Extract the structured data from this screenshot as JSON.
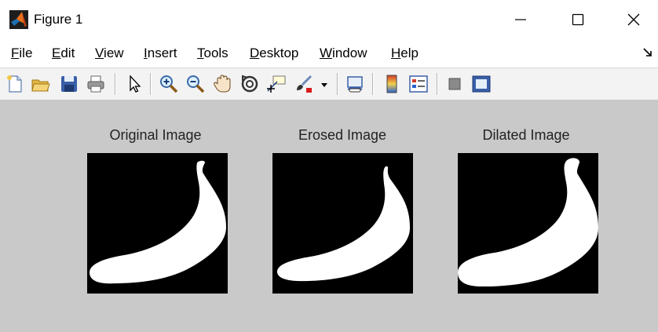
{
  "window": {
    "title": "Figure 1",
    "icon": "matlab-logo-icon",
    "controls": [
      "minimize-icon",
      "maximize-icon",
      "close-icon"
    ]
  },
  "menubar": {
    "items": [
      {
        "label": "File",
        "mnemonic": "F"
      },
      {
        "label": "Edit",
        "mnemonic": "E"
      },
      {
        "label": "View",
        "mnemonic": "V"
      },
      {
        "label": "Insert",
        "mnemonic": "I"
      },
      {
        "label": "Tools",
        "mnemonic": "T"
      },
      {
        "label": "Desktop",
        "mnemonic": "D"
      },
      {
        "label": "Window",
        "mnemonic": "W"
      },
      {
        "label": "Help",
        "mnemonic": "H"
      }
    ]
  },
  "toolbar": {
    "buttons": [
      "new-figure-icon",
      "open-icon",
      "save-icon",
      "print-icon",
      "pointer-icon",
      "zoom-in-icon",
      "zoom-out-icon",
      "pan-icon",
      "rotate-3d-icon",
      "data-cursor-icon",
      "brush-icon",
      "link-plot-icon",
      "colorbar-icon",
      "legend-icon",
      "hide-plot-tools-icon",
      "show-plot-tools-icon"
    ]
  },
  "figure": {
    "axes": [
      {
        "title": "Original Image"
      },
      {
        "title": "Erosed Image"
      },
      {
        "title": "Dilated Image"
      }
    ]
  },
  "colors": {
    "titlebar_bg": "#ffffff",
    "figure_bg": "#c9c9c9",
    "image_bg": "#000000",
    "image_fg": "#ffffff"
  }
}
